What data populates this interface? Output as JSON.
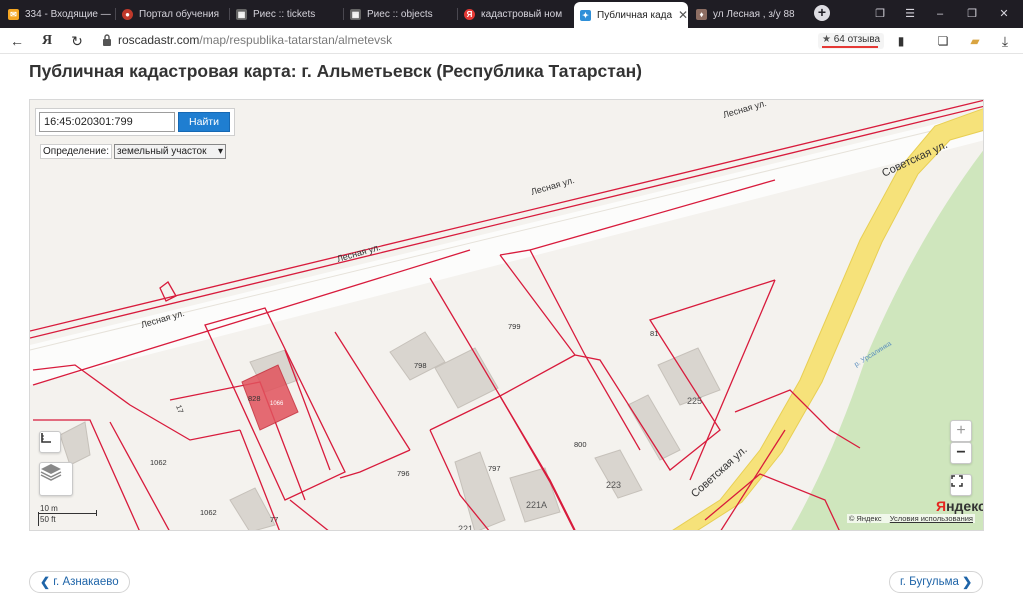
{
  "tabs": [
    {
      "label": "334 - Входящие —",
      "icon": "mail-icon",
      "color": "#f5a623",
      "glyph": "✉"
    },
    {
      "label": "Портал обучения",
      "icon": "portal-icon",
      "color": "#c0392b",
      "glyph": "●"
    },
    {
      "label": "Риес :: tickets",
      "icon": "grid-icon",
      "color": "#666666",
      "glyph": "▦"
    },
    {
      "label": "Риес :: objects",
      "icon": "grid-icon",
      "color": "#666666",
      "glyph": "▦"
    },
    {
      "label": "кадастровый ном",
      "icon": "yandex-icon",
      "color": "#e53935",
      "glyph": "Я"
    },
    {
      "label": "Публичная када",
      "icon": "rosreestr-icon",
      "color": "#2f8fd8",
      "glyph": "✦",
      "active": true
    },
    {
      "label": "ул Лесная , з/у 88",
      "icon": "pin-icon",
      "color": "#8d6e63",
      "glyph": "♦"
    }
  ],
  "address": {
    "domain": "roscadastr.com",
    "path": "/map/respublika-tatarstan/almetevsk",
    "reviews": "64 отзыва"
  },
  "page": {
    "title": "Публичная кадастровая карта: г. Альметьевск (Республика Татарстан)"
  },
  "map": {
    "search_value": "16:45:020301:799",
    "search_button": "Найти",
    "definition_label": "Определение:",
    "definition_value": "земельный участок",
    "streets": {
      "lesnaya_1": "Лесная ул.",
      "lesnaya_2": "Лесная ул.",
      "lesnaya_3": "Лесная ул.",
      "lesnaya_4": "Лесная ул.",
      "sovetskaya_1": "Советская ул.",
      "sovetskaya_2": "Советская ул.",
      "river": "р. Урсалинка"
    },
    "parcels": {
      "p799": "799",
      "p81": "81",
      "p798": "798",
      "p828": "828",
      "p1066": "1066",
      "p225": "225",
      "p800": "800",
      "p797": "797",
      "p796": "796",
      "p223": "223",
      "p221a": "221А",
      "p221": "221",
      "p1062a": "1062",
      "p1062b": "1062",
      "p77": "77",
      "p17": "17"
    },
    "scale_m": "10 m",
    "scale_ft": "50 ft",
    "zoom_in": "+",
    "zoom_out": "−",
    "copyright": "© Яндекс",
    "terms": "Условия использования",
    "logo_y": "Я",
    "logo_rest": "ндекс"
  },
  "pager": {
    "prev": "г. Азнакаево",
    "next": "г. Бугульма"
  },
  "colors": {
    "parcel": "#d81b3c",
    "selected": "#e2535d",
    "road": "#f6e27a",
    "park": "#cfe6bd",
    "button": "#1f7ed1"
  }
}
